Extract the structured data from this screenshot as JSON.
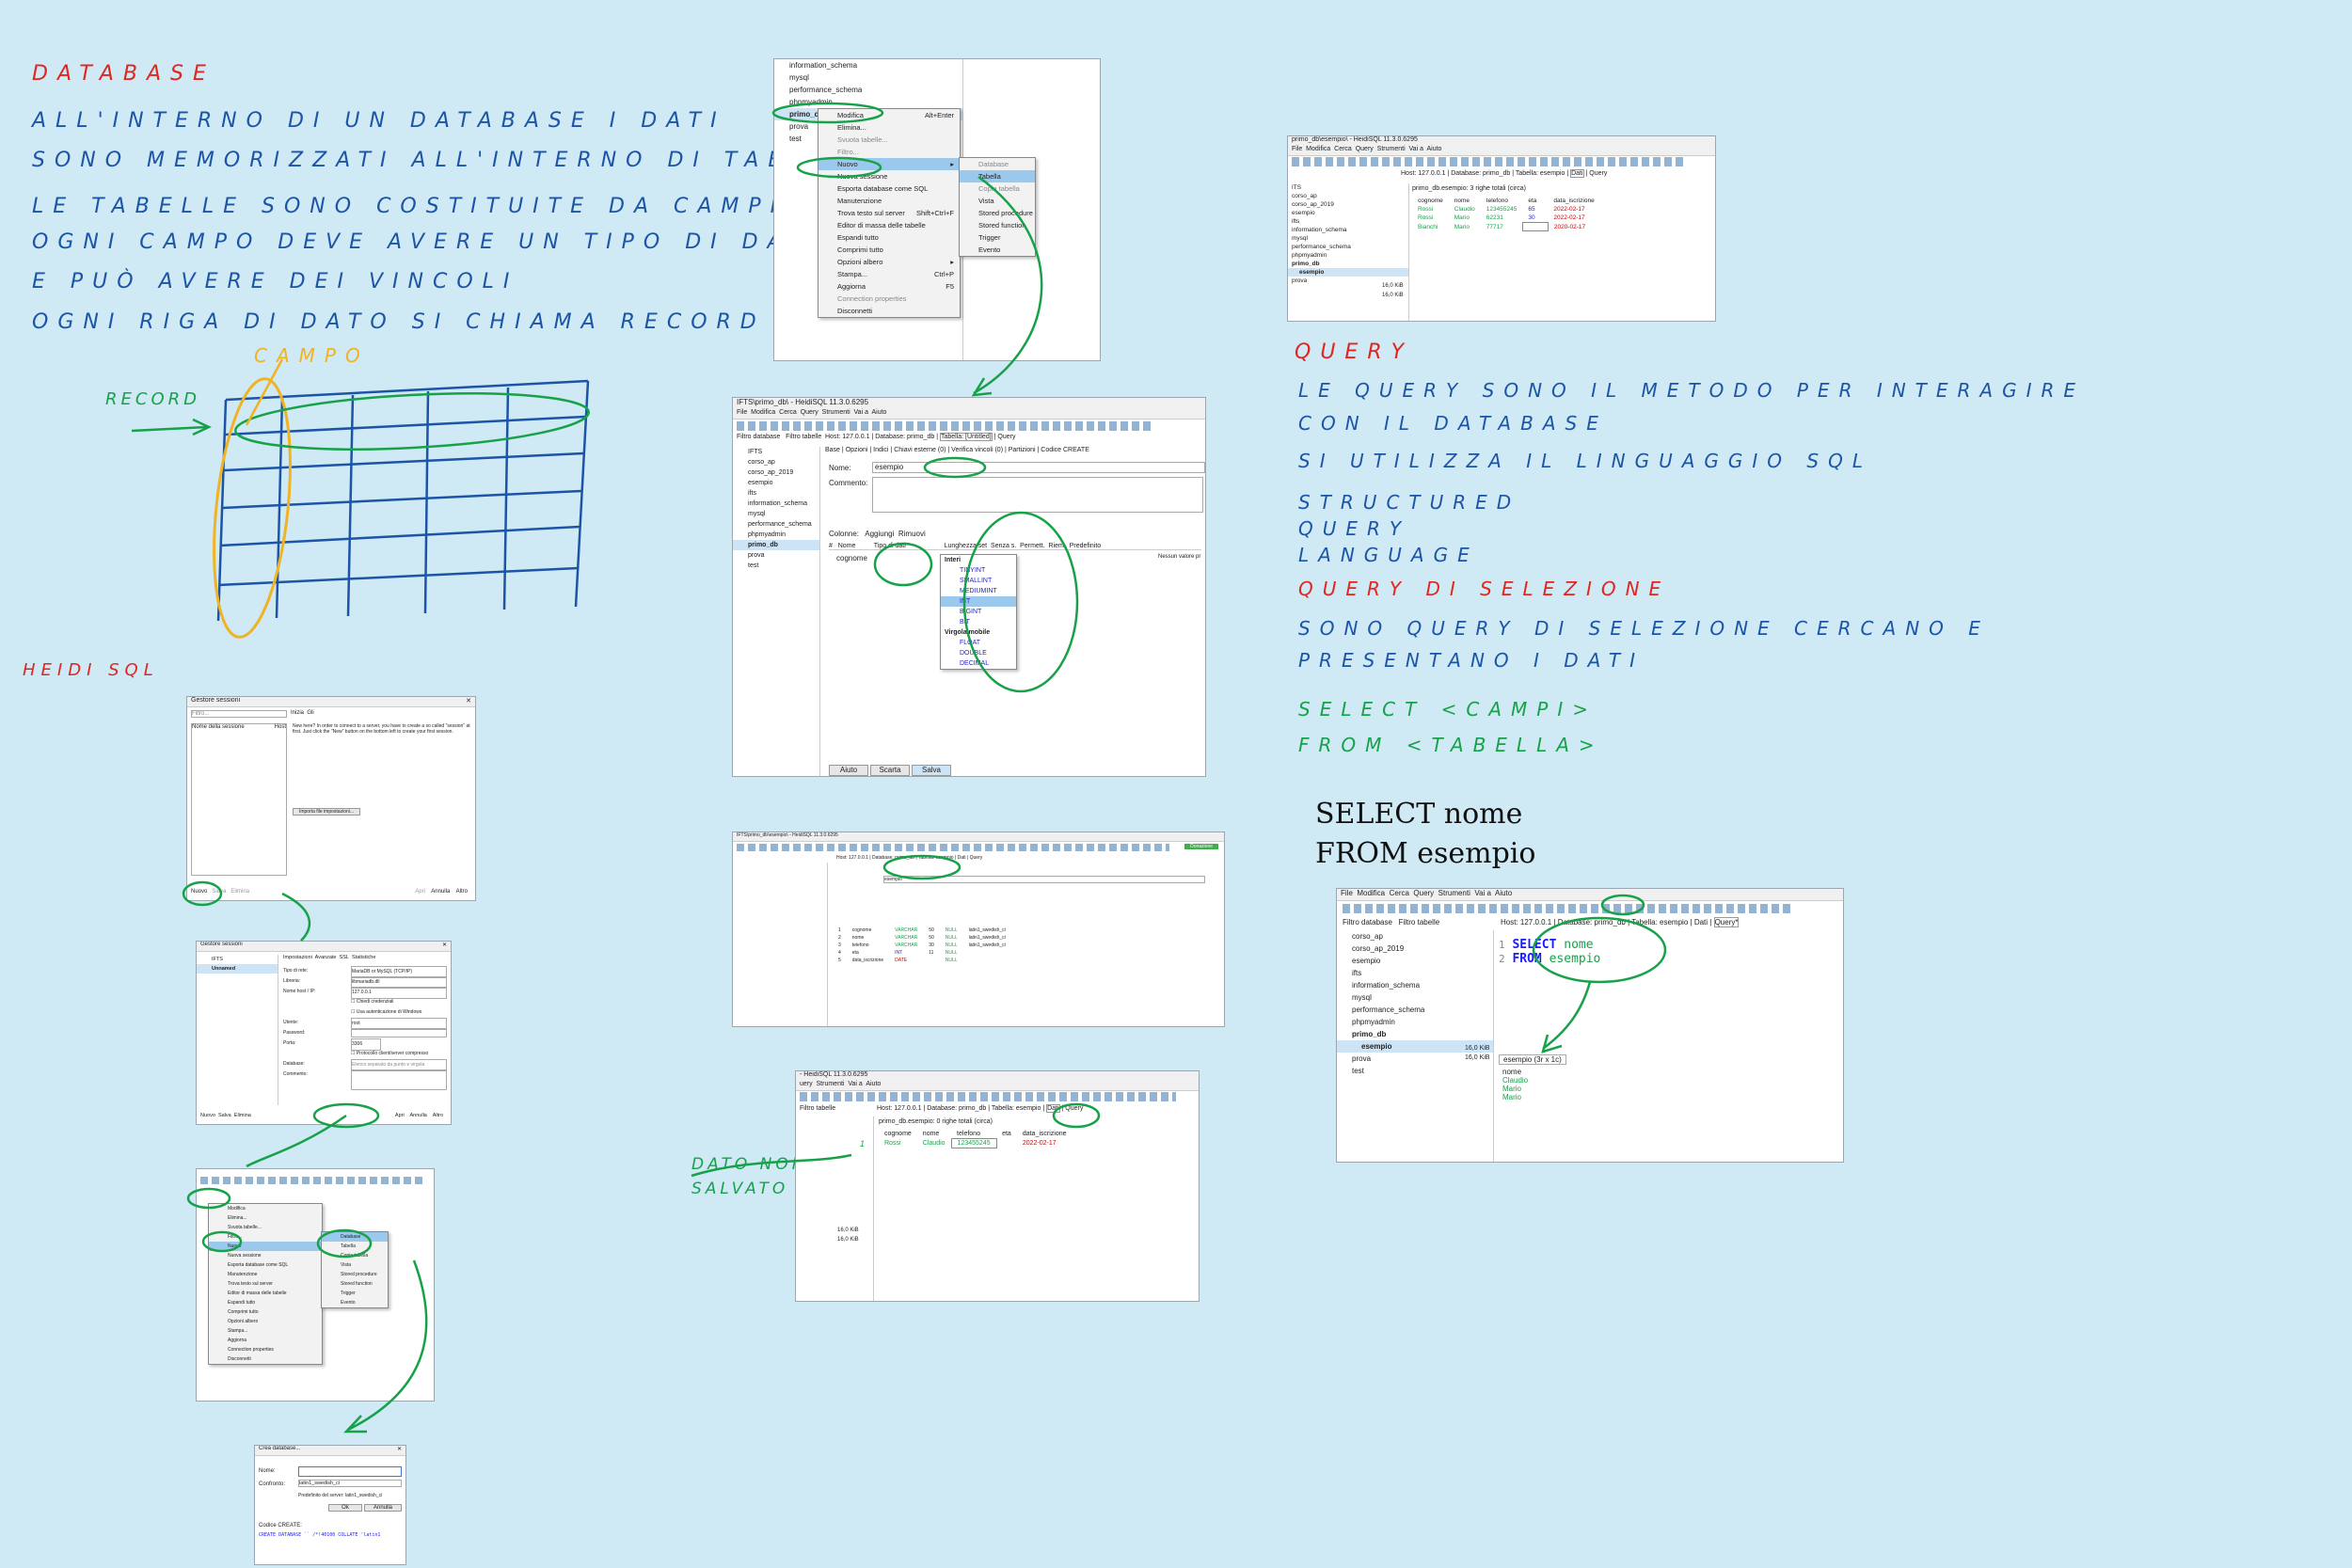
{
  "notes": {
    "heading": "DATABASE",
    "lines": [
      "ALL'INTERNO DI UN DATABASE I DATI",
      "SONO MEMORIZZATI ALL'INTERNO DI TABELLE",
      "LE TABELLE SONO COSTITUITE DA CAMPI",
      "OGNI CAMPO DEVE AVERE UN TIPO DI DATO",
      "E PUÒ AVERE DEI VINCOLI",
      "OGNI RIGA DI DATO SI CHIAMA RECORD"
    ],
    "campo_label": "CAMPO",
    "record_label": "RECORD",
    "heidi": "HEIDI SQL",
    "dato_non_salvato": [
      "DATO NON",
      "SALVATO"
    ],
    "query_heading": "QUERY",
    "query_lines": [
      "LE QUERY SONO IL METODO PER INTERAGIRE",
      "CON IL DATABASE",
      "SI UTILIZZA IL LINGUAGGIO SQL"
    ],
    "sql_acronym": [
      "STRUCTURED",
      "QUERY",
      "LANGUAGE"
    ],
    "selezione_heading": "QUERY DI SELEZIONE",
    "selezione_lines": [
      "SONO QUERY DI SELEZIONE CERCANO E",
      "PRESENTANO I DATI"
    ],
    "select_syntax": [
      "SELECT <CAMPI>",
      "FROM <TABELLA>"
    ],
    "typed_example": [
      "SELECT nome",
      "FROM esempio"
    ]
  },
  "shot_context_menu": {
    "tree": [
      "information_schema",
      "mysql",
      "performance_schema",
      "phpmyadmin",
      "primo_db",
      "prova",
      "test"
    ],
    "menu": [
      "Modifica",
      "Elimina...",
      "Svuota tabelle...",
      "Filtro...",
      "Nuovo",
      "Nuova sessione",
      "Esporta database come SQL",
      "Manutenzione",
      "Trova testo sul server",
      "Editor di massa delle tabelle",
      "Espandi tutto",
      "Comprimi tutto",
      "Opzioni albero",
      "Stampa...",
      "Aggiorna",
      "Connection properties",
      "Disconnetti"
    ],
    "shortcuts": {
      "modifica": "Alt+Enter",
      "trova": "Shift+Ctrl+F",
      "stampa": "Ctrl+P",
      "aggiorna": "F5"
    },
    "submenu": [
      "Database",
      "Tabella",
      "Copia tabella",
      "Vista",
      "Stored procedure",
      "Stored function",
      "Trigger",
      "Evento"
    ]
  },
  "shot_table_editor": {
    "title": "IFTS\\primo_db\\ - HeidiSQL 11.3.0.6295",
    "menubar": [
      "File",
      "Modifica",
      "Cerca",
      "Query",
      "Strumenti",
      "Vai a",
      "Aiuto"
    ],
    "filter_db": "Filtro database",
    "filter_tab": "Filtro tabelle",
    "tabs": [
      "Host: 127.0.0.1",
      "Database: primo_db",
      "Tabella: [Untitled]",
      "Query"
    ],
    "subtabs": [
      "Base",
      "Opzioni",
      "Indici",
      "Chiavi esterne (0)",
      "Verifica vincoli (0)",
      "Partizioni",
      "Codice CREATE"
    ],
    "tree": [
      "IFTS",
      "corso_ap",
      "corso_ap_2019",
      "esempio",
      "ifts",
      "information_schema",
      "mysql",
      "performance_schema",
      "phpmyadmin",
      "primo_db",
      "prova",
      "test"
    ],
    "name_label": "Nome:",
    "name_value": "esempio",
    "comment_label": "Commento:",
    "columns_label": "Colonne:",
    "add": "Aggiungi",
    "remove": "Rimuovi",
    "col_headers": [
      "#",
      "Nome",
      "Tipo di dati",
      "Lunghezza/set",
      "Senza s.",
      "Permett.",
      "Riem.",
      "Predefinito"
    ],
    "row_name": "cognome",
    "types": [
      "Interi",
      "TINYINT",
      "SMALLINT",
      "MEDIUMINT",
      "INT",
      "BIGINT",
      "BIT",
      "Virgola mobile",
      "FLOAT",
      "DOUBLE",
      "DECIMAL"
    ],
    "default_hint": "Nessun valore pr",
    "buttons": [
      "Aiuto",
      "Scarta",
      "Salva"
    ]
  },
  "shot_data_top": {
    "title": "primo_db\\esempio\\ - HeidiSQL 11.3.0.6295",
    "menubar": [
      "File",
      "Modifica",
      "Cerca",
      "Query",
      "Strumenti",
      "Vai a",
      "Aiuto"
    ],
    "tabs": [
      "Host: 127.0.0.1",
      "Database: primo_db",
      "Tabella: esempio",
      "Dati",
      "Query"
    ],
    "header": "primo_db.esempio: 3 righe totali (circa)",
    "tree": [
      "ITS",
      "corso_ap",
      "corso_ap_2019",
      "esempio",
      "ifts",
      "information_schema",
      "mysql",
      "performance_schema",
      "phpmyadmin",
      "primo_db",
      "esempio",
      "prova"
    ],
    "sizes": [
      "16,0 KiB",
      "16,0 KiB"
    ],
    "cols": [
      "cognome",
      "nome",
      "telefono",
      "eta",
      "data_iscrizione"
    ],
    "rows": [
      [
        "Rossi",
        "Claudio",
        "123455245",
        "65",
        "2022-02-17"
      ],
      [
        "Rossi",
        "Mario",
        "62231",
        "30",
        "2022-02-17"
      ],
      [
        "Bianchi",
        "Mario",
        "77717",
        "",
        "2020-02-17"
      ]
    ]
  },
  "shot_select": {
    "menubar": [
      "File",
      "Modifica",
      "Cerca",
      "Query",
      "Strumenti",
      "Vai a",
      "Aiuto"
    ],
    "filter_db": "Filtro database",
    "filter_tab": "Filtro tabelle",
    "tabs": [
      "Host: 127.0.0.1",
      "Database: primo_db",
      "Tabella: esempio",
      "Dati",
      "Query*"
    ],
    "tree": [
      "corso_ap",
      "corso_ap_2019",
      "esempio",
      "ifts",
      "information_schema",
      "mysql",
      "performance_schema",
      "phpmyadmin",
      "primo_db",
      "esempio",
      "prova",
      "test"
    ],
    "size_db": "16,0 KiB",
    "size_tab": "16,0 KiB",
    "line_numbers": [
      "1",
      "2"
    ],
    "kw1": "SELECT",
    "id1": "nome",
    "kw2": "FROM",
    "id2": "esempio",
    "result_tab": "esempio (3r x 1c)",
    "result_col": "nome",
    "result_rows": [
      "Claudio",
      "Mario",
      "Mario"
    ]
  },
  "shot_session": {
    "title": "Gestore sessioni",
    "filter": "Filtro...",
    "col1": "Nome della sessione",
    "col2": "Host",
    "tabs": [
      "Inizia",
      "Gli"
    ],
    "help": "New here? In order to connect to a server, you have to create a so called \"session\" at first. Just click the \"New\" button on the bottom left to create your first session.",
    "import": "Importa file impostazioni...",
    "buttons": [
      "Nuovo",
      "Salva",
      "Elimina",
      "Apri",
      "Annulla",
      "Altro"
    ]
  },
  "shot_session2": {
    "title": "Gestore sessioni",
    "tree": [
      "IFTS",
      "Unnamed"
    ],
    "tabs": [
      "Impostazioni",
      "Avanzate",
      "SSL",
      "Statistiche"
    ],
    "labels": [
      "Tipo di rete:",
      "Libreria:",
      "Nome host / IP:",
      "Utente:",
      "Password:",
      "Porta:",
      "Database:",
      "Commento:"
    ],
    "values": [
      "MariaDB or MySQL (TCP/IP)",
      "libmariadb.dll",
      "127.0.0.1",
      "root",
      "",
      "3306",
      "Elenco separato da punto e virgola",
      ""
    ],
    "checks": [
      "Chiedi credenziali",
      "Usa autenticazione di Windows",
      "Protocollo client/server compresso"
    ],
    "buttons": [
      "Nuovo",
      "Salva",
      "Elimina",
      "Apri",
      "Annulla",
      "Altro"
    ]
  },
  "shot_menu2": {
    "menu": [
      "Modifica",
      "Elimina...",
      "Svuota tabelle...",
      "Filtro...",
      "Nuovo",
      "Nuova sessione",
      "Esporta database come SQL",
      "Manutenzione",
      "Trova testo sul server",
      "Editor di massa delle tabelle",
      "Espandi tutto",
      "Comprimi tutto",
      "Opzioni albero",
      "Stampa...",
      "Aggiorna",
      "Connection properties",
      "Disconnetti"
    ],
    "submenu": [
      "Database",
      "Tabella",
      "Copia tabella",
      "Vista",
      "Stored procedure",
      "Stored function",
      "Trigger",
      "Evento"
    ]
  },
  "shot_create_db": {
    "title": "Crea database...",
    "name_label": "Nome:",
    "coll_label": "Confronto:",
    "coll_value": "latin1_swedish_ci",
    "default_text": "Predefinito del server: latin1_swedish_ci",
    "ok": "Ok",
    "cancel": "Annulla",
    "code_label": "Codice CREATE:",
    "code": "CREATE DATABASE `` /*!40100 COLLATE 'latin1"
  },
  "shot_table_full": {
    "title": "IFTS\\primo_db\\esempio\\ - HeidiSQL 11.3.0.6295",
    "tabs": [
      "Host: 127.0.0.1",
      "Database: primo_db",
      "Tabella: esempio",
      "Dati",
      "Query"
    ],
    "donate": "Donazione",
    "name_value": "esempio",
    "cols": [
      [
        "1",
        "cognome",
        "VARCHAR",
        "50"
      ],
      [
        "2",
        "nome",
        "VARCHAR",
        "50"
      ],
      [
        "3",
        "telefono",
        "VARCHAR",
        "30"
      ],
      [
        "4",
        "eta",
        "INT",
        "11"
      ],
      [
        "5",
        "data_iscrizione",
        "DATE",
        ""
      ]
    ],
    "defaults": [
      "NULL",
      "NULL",
      "NULL",
      "NULL",
      "NULL"
    ],
    "coll": "latin1_swedish_ci"
  },
  "shot_unsaved": {
    "title": "- HeidiSQL 11.3.0.6295",
    "menubar": [
      "uery",
      "Strumenti",
      "Vai a",
      "Aiuto"
    ],
    "filter_db": "Filtro tabelle",
    "tabs": [
      "Host: 127.0.0.1",
      "Database: primo_db",
      "Tabella: esempio",
      "Dati",
      "Query"
    ],
    "header": "primo_db.esempio: 0 righe totali (circa)",
    "cols": [
      "cognome",
      "nome",
      "telefono",
      "eta",
      "data_iscrizione"
    ],
    "row": [
      "Rossi",
      "Claudio",
      "123455245",
      "",
      "2022-02-17"
    ],
    "sizes": [
      "16,0 KiB",
      "16,0 KiB"
    ],
    "ink_row": "1"
  }
}
